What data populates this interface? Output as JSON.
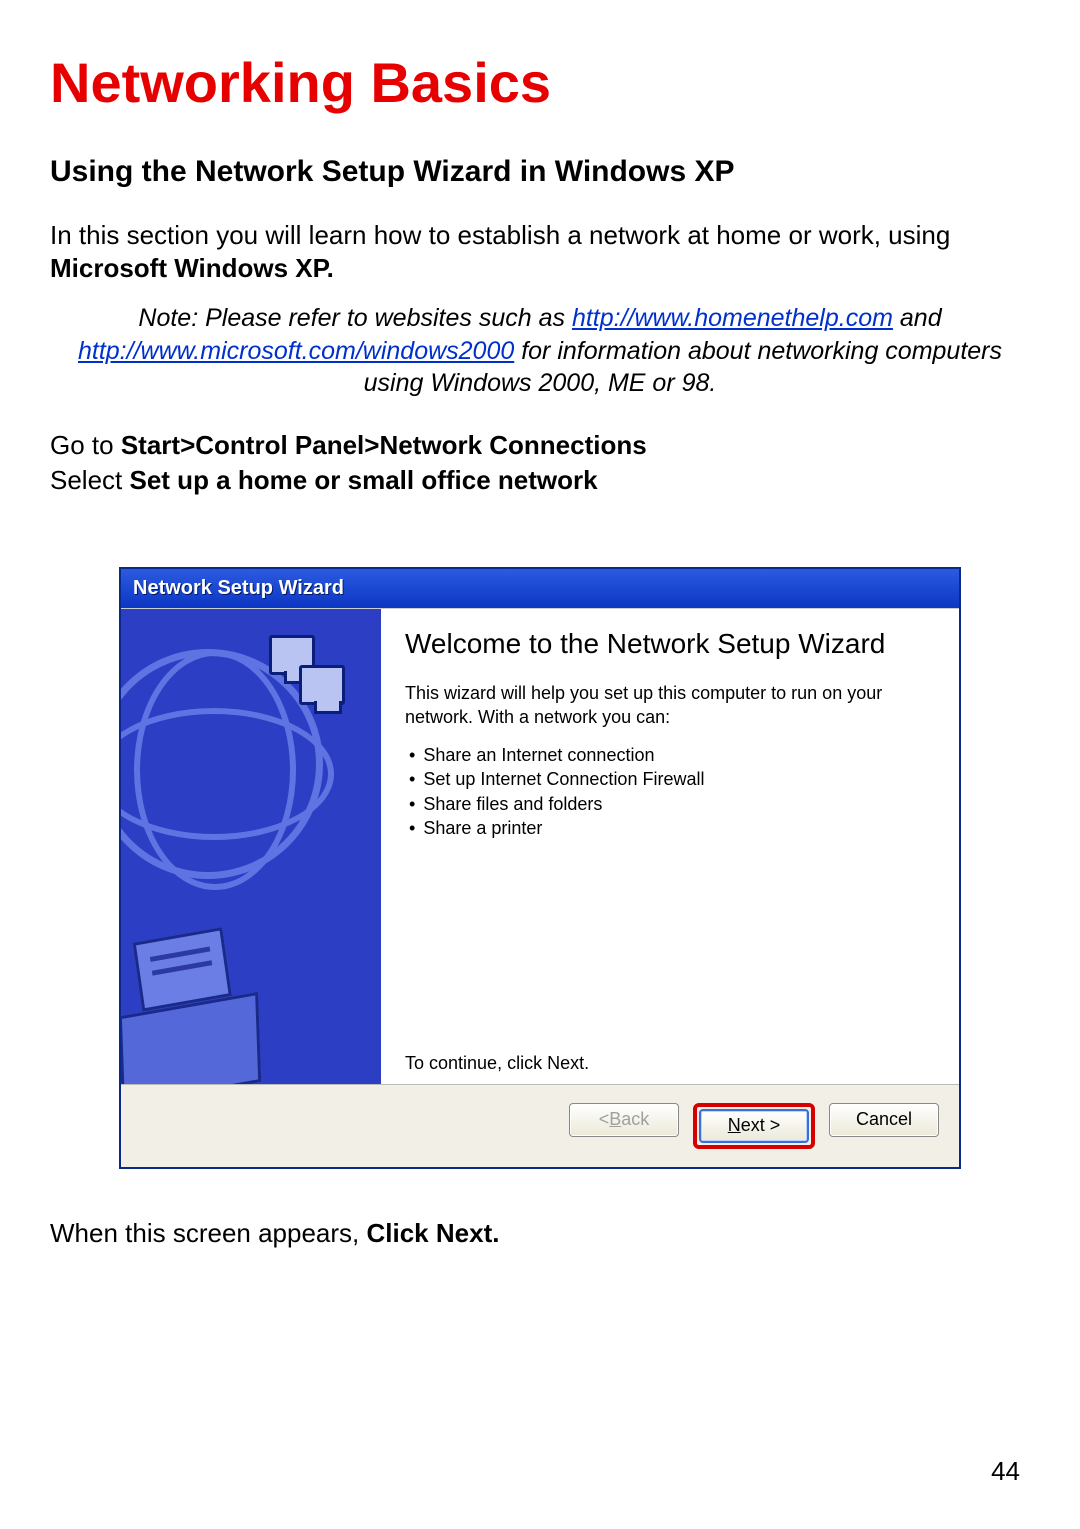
{
  "page": {
    "title": "Networking Basics",
    "subtitle": "Using the Network Setup Wizard in Windows XP",
    "intro_pre": "In this section you will learn how to establish a network at home or work, using ",
    "intro_bold": "Microsoft Windows XP.",
    "note_pre": "Note:  Please refer to websites such as ",
    "note_link1": "http://www.homenethelp.com",
    "note_mid1": " and ",
    "note_link2": "http://www.microsoft.com/windows2000",
    "note_mid2": "  for information about networking computers using Windows 2000, ME or 98.",
    "step1_pre": "Go to ",
    "step1_bold": "Start>Control Panel>Network Connections",
    "step2_pre": "Select ",
    "step2_bold": "Set up a home or small office network",
    "after_pre": "When this screen appears, ",
    "after_bold": "Click Next.",
    "page_number": "44"
  },
  "wizard": {
    "titlebar": "Network Setup Wizard",
    "heading": "Welcome to the Network Setup Wizard",
    "paragraph": "This wizard will help you set up this computer to run on your network. With a network you can:",
    "bullets": [
      "Share an Internet connection",
      "Set up Internet Connection Firewall",
      "Share files and folders",
      "Share a printer"
    ],
    "continue": "To continue, click Next.",
    "buttons": {
      "back_prefix": "< ",
      "back_hotkey": "B",
      "back_suffix": "ack",
      "next_hotkey": "N",
      "next_suffix": "ext >",
      "cancel": "Cancel"
    }
  }
}
